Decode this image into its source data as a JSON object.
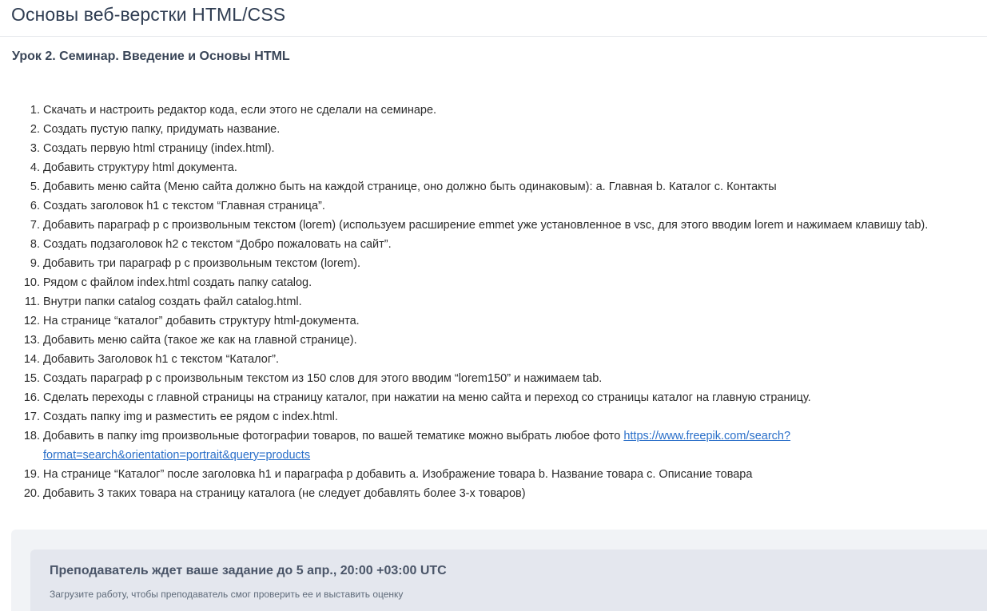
{
  "course": {
    "title": "Основы веб-верстки HTML/CSS"
  },
  "lesson": {
    "title": "Урок 2. Семинар. Введение и Основы HTML"
  },
  "tasks": [
    {
      "num": "1.",
      "text": "Скачать и настроить редактор кода, если этого не сделали на семинаре."
    },
    {
      "num": "2.",
      "text": "Создать пустую папку, придумать название."
    },
    {
      "num": "3.",
      "text": "Создать первую html страницу (index.html)."
    },
    {
      "num": "4.",
      "text": "Добавить структуру html документа."
    },
    {
      "num": "5.",
      "text": "Добавить меню сайта (Меню сайта должно быть на каждой странице, оно должно быть одинаковым): a. Главная b. Каталог c. Контакты"
    },
    {
      "num": "6.",
      "text": "Создать заголовок h1 с текстом “Главная страница”."
    },
    {
      "num": "7.",
      "text": "Добавить параграф p с произвольным текстом (lorem) (используем расширение emmet уже установленное в vsc, для этого вводим lorem и нажимаем клавишу tab)."
    },
    {
      "num": "8.",
      "text": "Создать подзаголовок h2 с текстом “Добро пожаловать на сайт”."
    },
    {
      "num": "9.",
      "text": "Добавить три параграф p с произвольным текстом (lorem)."
    },
    {
      "num": "10.",
      "text": "Рядом с файлом index.html создать папку catalog."
    },
    {
      "num": "11.",
      "text": "Внутри папки catalog создать файл catalog.html."
    },
    {
      "num": "12.",
      "text": "На странице “каталог” добавить структуру html-документа."
    },
    {
      "num": "13.",
      "text": "Добавить меню сайта (такое же как на главной странице)."
    },
    {
      "num": "14.",
      "text": "Добавить Заголовок h1 с текстом “Каталог”."
    },
    {
      "num": "15.",
      "text": "Создать параграф p с произвольным текстом из 150 слов для этого вводим “lorem150” и нажимаем tab."
    },
    {
      "num": "16.",
      "text": "Сделать переходы с главной страницы на страницу каталог, при нажатии на меню сайта и переход со страницы каталог на главную страницу."
    },
    {
      "num": "17.",
      "text": "Создать папку img и разместить ее рядом с index.html."
    },
    {
      "num": "18.",
      "text": "Добавить в папку img произвольные фотографии товаров, по вашей тематике можно выбрать любое фото ",
      "link_line1": "https://www.freepik.com/search?",
      "link_line2": "format=search&orientation=portrait&query=products"
    },
    {
      "num": "19.",
      "text": "На странице “Каталог” после заголовка h1 и параграфа p добавить a. Изображение товара b. Название товара c. Описание товара"
    },
    {
      "num": "20.",
      "text": "Добавить 3 таких товара на страницу каталога (не следует добавлять более 3-х товаров)"
    }
  ],
  "submission": {
    "deadline_text": "Преподаватель ждет ваше задание до 5 апр., 20:00 +03:00 UTC",
    "hint_text": "Загрузите работу, чтобы преподаватель смог проверить ее и выставить оценку"
  },
  "colors": {
    "link": "#2a6fc9",
    "panel_outer": "#f1f3f6",
    "panel_inner": "#e4e7ee"
  }
}
